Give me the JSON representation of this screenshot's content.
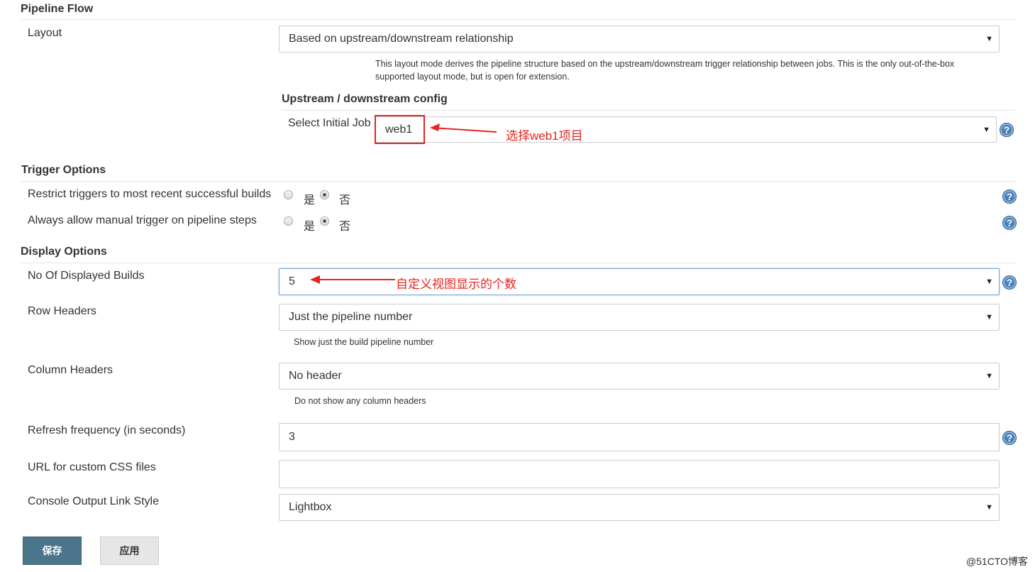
{
  "pipeline_flow": {
    "header": "Pipeline Flow",
    "layout_label": "Layout",
    "layout_value": "Based on upstream/downstream relationship",
    "layout_desc": "This layout mode derives the pipeline structure based on the upstream/downstream trigger relationship between jobs. This is the only out-of-the-box supported layout mode, but is open for extension.",
    "upstream_header": "Upstream / downstream config",
    "initial_job_label": "Select Initial Job",
    "initial_job_value": "web1",
    "annotation_initial_job": "选择web1项目"
  },
  "trigger_options": {
    "header": "Trigger Options",
    "restrict_label": "Restrict triggers to most recent successful builds",
    "restrict_selected": "否",
    "manual_label": "Always allow manual trigger on pipeline steps",
    "manual_selected": "否",
    "yes_label": "是",
    "no_label": "否"
  },
  "display_options": {
    "header": "Display Options",
    "builds_label": "No Of Displayed Builds",
    "builds_value": "5",
    "annotation_builds": "自定义视图显示的个数",
    "row_headers_label": "Row Headers",
    "row_headers_value": "Just the pipeline number",
    "row_headers_desc": "Show just the build pipeline number",
    "column_headers_label": "Column Headers",
    "column_headers_value": "No header",
    "column_headers_desc": "Do not show any column headers",
    "refresh_label": "Refresh frequency (in seconds)",
    "refresh_value": "3",
    "css_label": "URL for custom CSS files",
    "css_value": "",
    "console_label": "Console Output Link Style",
    "console_value": "Lightbox"
  },
  "buttons": {
    "save": "保存",
    "apply": "应用"
  },
  "help_glyph": "?",
  "dropdown_glyph": "▼",
  "watermark": "@51CTO博客",
  "colors": {
    "annotation": "#e8231f",
    "primary_button": "#4b758b",
    "help_icon": "#4a7fb6"
  }
}
